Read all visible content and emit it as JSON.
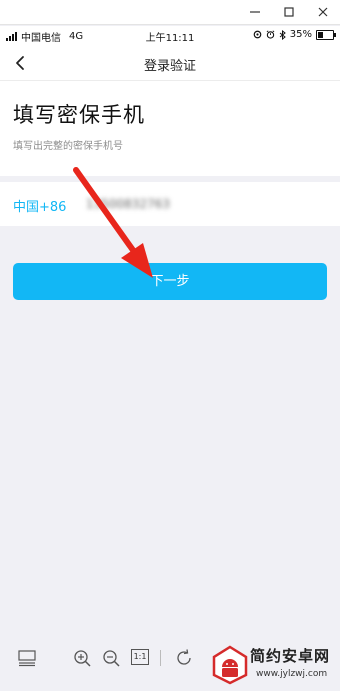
{
  "viewer": {
    "titlebar": {
      "minimize_icon": "minimize-icon",
      "maximize_icon": "maximize-icon",
      "close_icon": "close-icon"
    },
    "toolbar": {
      "one_to_one_label": "1:1"
    }
  },
  "status_bar": {
    "carrier": "中国电信",
    "network": "4G",
    "time": "上午11:11",
    "battery_percent_label": "35%",
    "battery_level": 0.35
  },
  "nav": {
    "title": "登录验证"
  },
  "form": {
    "heading": "填写密保手机",
    "subtitle": "填写出完整的密保手机号",
    "country_code": "中国+86",
    "phone_value": "13500832763"
  },
  "next_button": {
    "label": "下一步"
  },
  "watermark": {
    "title": "简约安卓网",
    "url": "www.jylzwj.com"
  },
  "colors": {
    "accent": "#12b7f5",
    "annotation_arrow": "#e8261c",
    "background": "#f0f0f5"
  }
}
